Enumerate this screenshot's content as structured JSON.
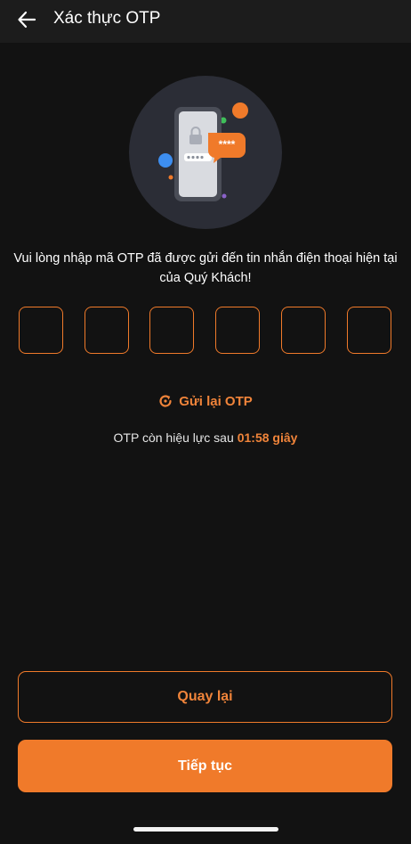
{
  "header": {
    "title": "Xác thực OTP"
  },
  "illustration": {
    "bubble_text": "****"
  },
  "instruction": "Vui lòng nhập mã OTP đã được gửi đến tin nhắn điện thoại hiện tại của Quý Khách!",
  "otp": {
    "digits": [
      "",
      "",
      "",
      "",
      "",
      ""
    ]
  },
  "resend": {
    "label": "Gửi lại OTP"
  },
  "timer": {
    "prefix": "OTP còn hiệu lực sau",
    "value": "01:58 giây"
  },
  "actions": {
    "back_label": "Quay lại",
    "continue_label": "Tiếp tục"
  },
  "colors": {
    "accent": "#f07a2a",
    "background": "#121212",
    "header": "#1c1c1c"
  },
  "icons": [
    "back-arrow-icon",
    "refresh-icon",
    "lock-icon"
  ]
}
